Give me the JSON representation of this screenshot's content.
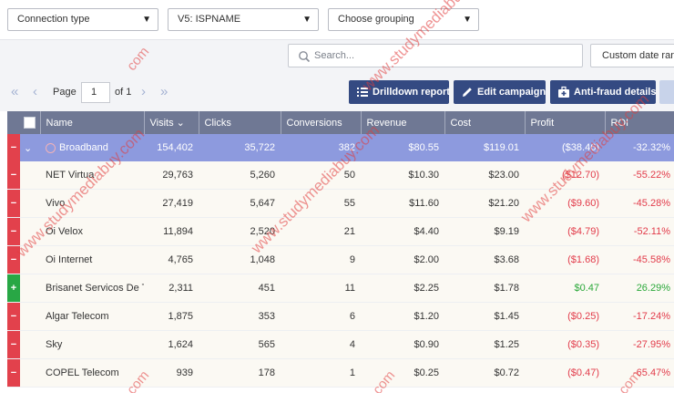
{
  "filters": {
    "connection_type": "Connection type",
    "v5": "V5: ISPNAME",
    "grouping": "Choose grouping"
  },
  "search": {
    "placeholder": "Search..."
  },
  "date_button": "Custom date ran",
  "pager": {
    "page_label": "Page",
    "page": "1",
    "of_label": "of 1"
  },
  "toolbar": {
    "drilldown": "Drilldown report",
    "edit_campaign": "Edit campaign",
    "antifraud": "Anti-fraud details"
  },
  "columns": [
    "Name",
    "Visits",
    "Clicks",
    "Conversions",
    "Revenue",
    "Cost",
    "Profit",
    "ROI"
  ],
  "group": {
    "toggle": "−",
    "name": "Broadband",
    "visits": "154,402",
    "clicks": "35,722",
    "conversions": "382",
    "revenue": "$80.55",
    "cost": "$119.01",
    "profit": "($38.46)",
    "roi": "-32.32%"
  },
  "rows": [
    {
      "toggle": "−",
      "name": "NET Virtua",
      "visits": "29,763",
      "clicks": "5,260",
      "conversions": "50",
      "revenue": "$10.30",
      "cost": "$23.00",
      "profit": "($12.70)",
      "roi": "-55.22%"
    },
    {
      "toggle": "−",
      "name": "Vivo",
      "visits": "27,419",
      "clicks": "5,647",
      "conversions": "55",
      "revenue": "$11.60",
      "cost": "$21.20",
      "profit": "($9.60)",
      "roi": "-45.28%"
    },
    {
      "toggle": "−",
      "name": "Oi Velox",
      "visits": "11,894",
      "clicks": "2,520",
      "conversions": "21",
      "revenue": "$4.40",
      "cost": "$9.19",
      "profit": "($4.79)",
      "roi": "-52.11%"
    },
    {
      "toggle": "−",
      "name": "Oi Internet",
      "visits": "4,765",
      "clicks": "1,048",
      "conversions": "9",
      "revenue": "$2.00",
      "cost": "$3.68",
      "profit": "($1.68)",
      "roi": "-45.58%"
    },
    {
      "toggle": "+",
      "name": "Brisanet Servicos De T",
      "visits": "2,311",
      "clicks": "451",
      "conversions": "11",
      "revenue": "$2.25",
      "cost": "$1.78",
      "profit": "$0.47",
      "roi": "26.29%"
    },
    {
      "toggle": "−",
      "name": "Algar Telecom",
      "visits": "1,875",
      "clicks": "353",
      "conversions": "6",
      "revenue": "$1.20",
      "cost": "$1.45",
      "profit": "($0.25)",
      "roi": "-17.24%"
    },
    {
      "toggle": "−",
      "name": "Sky",
      "visits": "1,624",
      "clicks": "565",
      "conversions": "4",
      "revenue": "$0.90",
      "cost": "$1.25",
      "profit": "($0.35)",
      "roi": "-27.95%"
    },
    {
      "toggle": "−",
      "name": "COPEL Telecom",
      "visits": "939",
      "clicks": "178",
      "conversions": "1",
      "revenue": "$0.25",
      "cost": "$0.72",
      "profit": "($0.47)",
      "roi": "-65.47%"
    }
  ],
  "watermarks": {
    "long": "www.studymediabuy.com",
    "short": "com"
  },
  "colors": {
    "primary": "#344a82",
    "header": "#6f7894",
    "group_row": "#8d9ade",
    "negative": "#e23b4a",
    "positive": "#2ba83a",
    "row_marker": "#e2414c"
  }
}
